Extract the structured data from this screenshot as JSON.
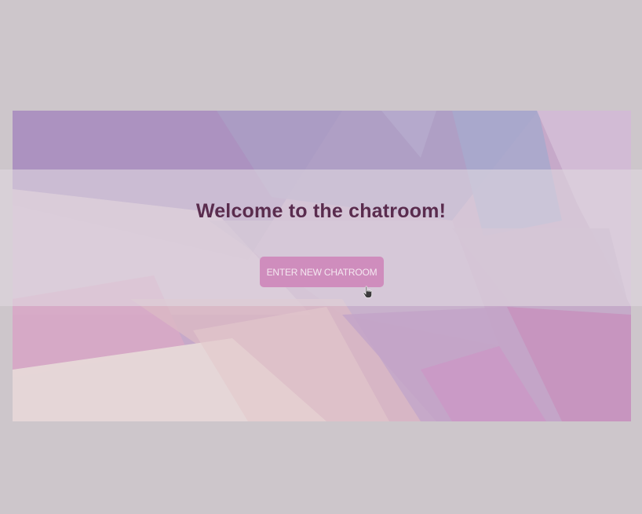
{
  "page": {
    "title": "Welcome to the chatroom!",
    "enter_button_label": "ENTER NEW CHATROOM"
  },
  "colors": {
    "background": "#cdc6cb",
    "title": "#5a2c4e",
    "button": "#cf8dbd",
    "button_text": "#f4e7f0"
  },
  "icons": {
    "cursor": "hand-pointer-icon"
  }
}
